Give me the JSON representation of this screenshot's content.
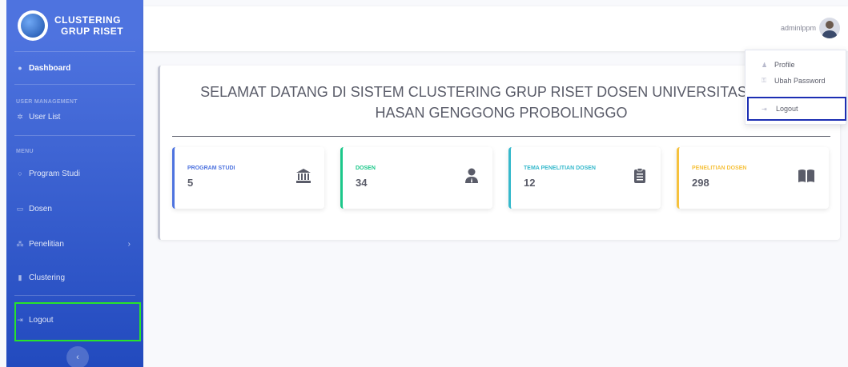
{
  "brand": {
    "line1": "CLUSTERING",
    "line2": "GRUP RISET"
  },
  "sidebar": {
    "dashboard": "Dashboard",
    "heading_user": "USER MANAGEMENT",
    "user_list": "User List",
    "heading_menu": "MENU",
    "program_studi": "Program Studi",
    "dosen": "Dosen",
    "penelitian": "Penelitian",
    "clustering": "Clustering",
    "logout": "Logout",
    "toggle": "‹"
  },
  "topbar": {
    "user_name": "adminlppm"
  },
  "dropdown": {
    "profile": "Profile",
    "ubah_password": "Ubah Password",
    "logout": "Logout"
  },
  "welcome": {
    "line1": "SELAMAT DATANG DI SISTEM CLUSTERING GRUP RISET DOSEN UNIVERSITAS ZAINUL",
    "line2": "HASAN GENGGONG PROBOLINGGO"
  },
  "stats": [
    {
      "label": "PROGRAM STUDI",
      "value": "5",
      "icon": "university-icon",
      "color": "#4e73df"
    },
    {
      "label": "DOSEN",
      "value": "34",
      "icon": "user-tie-icon",
      "color": "#1cc88a"
    },
    {
      "label": "TEMA PENELITIAN DOSEN",
      "value": "12",
      "icon": "clipboard-list-icon",
      "color": "#36b9cc"
    },
    {
      "label": "PENELITIAN DOSEN",
      "value": "298",
      "icon": "book-open-icon",
      "color": "#f6c23e"
    }
  ]
}
